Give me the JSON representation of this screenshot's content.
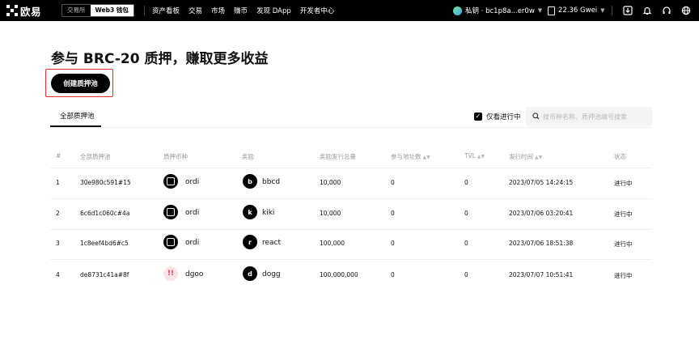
{
  "topbar": {
    "logo_text": "欧易",
    "mode_exchange": "交易所",
    "mode_wallet": "Web3 钱包",
    "nav": [
      "资产看板",
      "交易",
      "市场",
      "赚币",
      "发现 DApp",
      "开发者中心"
    ],
    "wallet_label": "私钥 · bc1p8a...er0w",
    "gas_label": "22.36 Gwei",
    "icons": [
      "download-icon",
      "bell-icon",
      "headset-icon",
      "globe-icon"
    ]
  },
  "page": {
    "title": "参与 BRC-20 质押，赚取更多收益",
    "create_button": "创建质押池",
    "tab_all": "全部质押池",
    "filter_active_label": "仅看进行中",
    "filter_active_checked": true,
    "search_placeholder": "搜币种名称、质押池编号搜索",
    "accent_highlight": "#e0312f"
  },
  "table": {
    "headers": {
      "index": "#",
      "pool": "全部质押池",
      "stake_token": "质押币种",
      "reward": "奖励",
      "reward_total": "奖励发行总量",
      "participants": "参与地址数",
      "tvl": "TVL",
      "issue_time": "发行时间",
      "status": "状态"
    },
    "rows": [
      {
        "index": "1",
        "pool": "30e980c591#15",
        "stake_token": "ordi",
        "stake_icon": "O",
        "reward": "bbcd",
        "reward_icon": "b",
        "reward_total": "10,000",
        "participants": "0",
        "tvl": "0",
        "issue_time": "2023/07/05 14:24:15",
        "status": "进行中"
      },
      {
        "index": "2",
        "pool": "6c6d1c060c#4a",
        "stake_token": "ordi",
        "stake_icon": "O",
        "reward": "kiki",
        "reward_icon": "k",
        "reward_total": "10,000",
        "participants": "0",
        "tvl": "0",
        "issue_time": "2023/07/06 03:20:41",
        "status": "进行中"
      },
      {
        "index": "3",
        "pool": "1c8eef4bd6#c5",
        "stake_token": "ordi",
        "stake_icon": "O",
        "reward": "react",
        "reward_icon": "r",
        "reward_total": "100,000",
        "participants": "0",
        "tvl": "0",
        "issue_time": "2023/07/06 18:51:38",
        "status": "进行中"
      },
      {
        "index": "4",
        "pool": "de8731c41a#8f",
        "stake_token": "dgoo",
        "stake_icon": "!!",
        "reward": "dogg",
        "reward_icon": "d",
        "reward_total": "100,000,000",
        "participants": "0",
        "tvl": "0",
        "issue_time": "2023/07/07 10:51:41",
        "status": "进行中"
      }
    ]
  }
}
